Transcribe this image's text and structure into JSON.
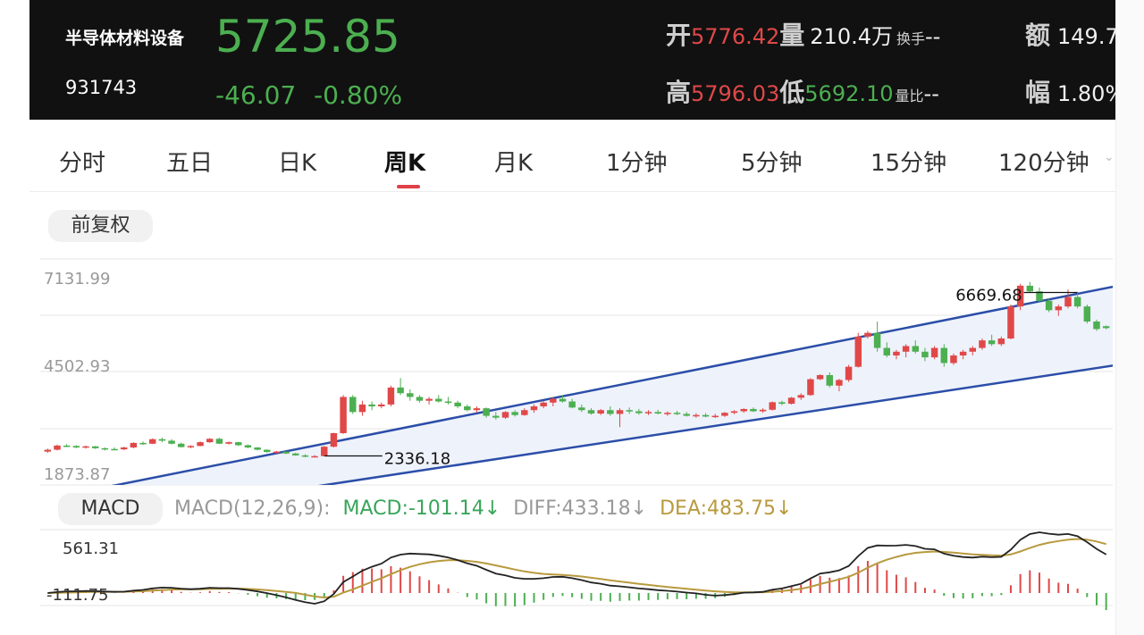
{
  "header": {
    "name": "半导体材料设备",
    "code": "931743",
    "price": "5725.85",
    "change": "-46.07",
    "change_pct": "-0.80%",
    "stats": {
      "open_label": "开",
      "open_value": "5776.42",
      "volume_label": "量",
      "volume_value": "210.4万",
      "turnover_label": "换手",
      "turnover_value": "--",
      "amount_label": "额",
      "amount_value": "149.7",
      "high_label": "高",
      "high_value": "5796.03",
      "low_label": "低",
      "low_value": "5692.10",
      "vol_ratio_label": "量比",
      "vol_ratio_value": "--",
      "amplitude_label": "幅",
      "amplitude_value": "1.80%"
    }
  },
  "tabs": [
    {
      "label": "分时"
    },
    {
      "label": "五日"
    },
    {
      "label": "日K"
    },
    {
      "label": "周K"
    },
    {
      "label": "月K"
    },
    {
      "label": "1分钟"
    },
    {
      "label": "5分钟"
    },
    {
      "label": "15分钟"
    },
    {
      "label": "120分钟"
    }
  ],
  "active_tab": "周K",
  "adjust_label": "前复权",
  "macd_panel": {
    "button_label": "MACD",
    "params_label": "MACD(12,26,9):",
    "macd_label": "MACD:-101.14↓",
    "diff_label": "DIFF:433.18↓",
    "dea_label": "DEA:483.75↓"
  },
  "colors": {
    "up": "#e04848",
    "down": "#4caf50",
    "channel": "#2b4ea8",
    "channel_fill": "#eef2fb",
    "dea": "#b89a3e",
    "diff": "#222222",
    "header_bg": "#111111"
  },
  "chart_data": [
    {
      "type": "candlestick",
      "y_tick_labels": [
        "7131.99",
        "4502.93",
        "1873.87"
      ],
      "ylim": [
        1873.87,
        7131.99
      ],
      "annotations": [
        {
          "label": "6669.68",
          "value": 6669.68,
          "kind": "high"
        },
        {
          "label": "2336.18",
          "value": 2336.18,
          "kind": "low"
        }
      ],
      "channel": {
        "upper": [
          [
            0,
            1200
          ],
          [
            119,
            7190
          ]
        ],
        "lower": [
          [
            0,
            450
          ],
          [
            119,
            5010
          ]
        ]
      },
      "ohlc": [
        [
          2450,
          2530,
          2420,
          2500
        ],
        [
          2500,
          2640,
          2480,
          2610
        ],
        [
          2610,
          2650,
          2570,
          2600
        ],
        [
          2600,
          2620,
          2540,
          2560
        ],
        [
          2560,
          2610,
          2530,
          2590
        ],
        [
          2590,
          2600,
          2520,
          2540
        ],
        [
          2540,
          2560,
          2480,
          2520
        ],
        [
          2520,
          2560,
          2490,
          2510
        ],
        [
          2510,
          2580,
          2490,
          2560
        ],
        [
          2560,
          2700,
          2540,
          2680
        ],
        [
          2680,
          2720,
          2630,
          2660
        ],
        [
          2660,
          2800,
          2650,
          2780
        ],
        [
          2780,
          2820,
          2700,
          2740
        ],
        [
          2740,
          2780,
          2640,
          2660
        ],
        [
          2660,
          2690,
          2560,
          2570
        ],
        [
          2570,
          2620,
          2540,
          2600
        ],
        [
          2600,
          2720,
          2590,
          2700
        ],
        [
          2700,
          2810,
          2680,
          2790
        ],
        [
          2790,
          2820,
          2650,
          2660
        ],
        [
          2660,
          2720,
          2640,
          2700
        ],
        [
          2700,
          2710,
          2600,
          2620
        ],
        [
          2620,
          2640,
          2540,
          2560
        ],
        [
          2560,
          2570,
          2480,
          2500
        ],
        [
          2500,
          2510,
          2420,
          2440
        ],
        [
          2440,
          2470,
          2400,
          2450
        ],
        [
          2450,
          2460,
          2380,
          2400
        ],
        [
          2400,
          2420,
          2340,
          2350
        ],
        [
          2350,
          2380,
          2300,
          2320
        ],
        [
          2320,
          2360,
          2310,
          2330
        ],
        [
          2330,
          2600,
          2336,
          2580
        ],
        [
          2580,
          2950,
          2560,
          2940
        ],
        [
          2940,
          3950,
          2920,
          3900
        ],
        [
          3900,
          3950,
          3450,
          3500
        ],
        [
          3500,
          3800,
          3400,
          3700
        ],
        [
          3700,
          3780,
          3550,
          3650
        ],
        [
          3650,
          3750,
          3600,
          3700
        ],
        [
          3700,
          4200,
          3650,
          4150
        ],
        [
          4150,
          4400,
          3950,
          4000
        ],
        [
          4000,
          4100,
          3800,
          3900
        ],
        [
          3900,
          3950,
          3750,
          3800
        ],
        [
          3800,
          3900,
          3700,
          3850
        ],
        [
          3850,
          3950,
          3750,
          3780
        ],
        [
          3780,
          3900,
          3700,
          3750
        ],
        [
          3750,
          3800,
          3600,
          3650
        ],
        [
          3650,
          3700,
          3520,
          3550
        ],
        [
          3550,
          3650,
          3480,
          3600
        ],
        [
          3600,
          3620,
          3350,
          3400
        ],
        [
          3400,
          3500,
          3300,
          3350
        ],
        [
          3350,
          3520,
          3320,
          3500
        ],
        [
          3500,
          3550,
          3380,
          3420
        ],
        [
          3420,
          3600,
          3400,
          3550
        ],
        [
          3550,
          3700,
          3480,
          3650
        ],
        [
          3650,
          3800,
          3600,
          3750
        ],
        [
          3750,
          3900,
          3650,
          3850
        ],
        [
          3850,
          3950,
          3750,
          3780
        ],
        [
          3780,
          3850,
          3600,
          3620
        ],
        [
          3620,
          3700,
          3500,
          3550
        ],
        [
          3550,
          3600,
          3430,
          3460
        ],
        [
          3460,
          3580,
          3420,
          3550
        ],
        [
          3550,
          3650,
          3400,
          3450
        ],
        [
          3450,
          3600,
          3100,
          3550
        ],
        [
          3550,
          3620,
          3450,
          3520
        ],
        [
          3520,
          3580,
          3430,
          3470
        ],
        [
          3470,
          3550,
          3420,
          3500
        ],
        [
          3500,
          3560,
          3440,
          3460
        ],
        [
          3460,
          3520,
          3400,
          3480
        ],
        [
          3480,
          3530,
          3420,
          3450
        ],
        [
          3450,
          3500,
          3380,
          3400
        ],
        [
          3400,
          3470,
          3350,
          3420
        ],
        [
          3420,
          3470,
          3360,
          3380
        ],
        [
          3380,
          3450,
          3340,
          3400
        ],
        [
          3400,
          3500,
          3370,
          3480
        ],
        [
          3480,
          3550,
          3440,
          3520
        ],
        [
          3520,
          3600,
          3480,
          3580
        ],
        [
          3580,
          3620,
          3500,
          3520
        ],
        [
          3520,
          3600,
          3480,
          3560
        ],
        [
          3560,
          3780,
          3540,
          3760
        ],
        [
          3760,
          3800,
          3680,
          3720
        ],
        [
          3720,
          3900,
          3700,
          3880
        ],
        [
          3880,
          4000,
          3820,
          3950
        ],
        [
          3950,
          4400,
          3930,
          4370
        ],
        [
          4370,
          4500,
          4350,
          4480
        ],
        [
          4480,
          4550,
          4150,
          4200
        ],
        [
          4200,
          4380,
          4050,
          4350
        ],
        [
          4350,
          4750,
          4300,
          4700
        ],
        [
          4700,
          5600,
          4680,
          5500
        ],
        [
          5500,
          5650,
          5450,
          5600
        ],
        [
          5600,
          5900,
          5100,
          5200
        ],
        [
          5200,
          5350,
          4950,
          5000
        ],
        [
          5000,
          5150,
          4900,
          5100
        ],
        [
          5100,
          5300,
          4950,
          5250
        ],
        [
          5250,
          5400,
          5050,
          5100
        ],
        [
          5100,
          5200,
          4850,
          4950
        ],
        [
          4950,
          5250,
          4900,
          5200
        ],
        [
          5200,
          5300,
          4700,
          4800
        ],
        [
          4800,
          5050,
          4750,
          5000
        ],
        [
          5000,
          5150,
          4900,
          5100
        ],
        [
          5100,
          5250,
          5000,
          5200
        ],
        [
          5200,
          5450,
          5150,
          5400
        ],
        [
          5400,
          5550,
          5250,
          5300
        ],
        [
          5300,
          5500,
          5250,
          5450
        ],
        [
          5450,
          6350,
          5430,
          6300
        ],
        [
          6300,
          6900,
          6200,
          6850
        ],
        [
          6850,
          6950,
          6669.68,
          6700
        ],
        [
          6700,
          6800,
          6400,
          6450
        ],
        [
          6450,
          6500,
          6150,
          6200
        ],
        [
          6200,
          6350,
          6050,
          6300
        ],
        [
          6300,
          6750,
          6250,
          6550
        ],
        [
          6550,
          6650,
          6250,
          6300
        ],
        [
          6300,
          6350,
          5850,
          5900
        ],
        [
          5900,
          5950,
          5650,
          5700
        ],
        [
          5776.42,
          5796.03,
          5692.1,
          5725.85
        ]
      ]
    },
    {
      "type": "macd",
      "params": "12,26,9",
      "y_tick_labels": [
        "561.31",
        "-111.75"
      ],
      "ylim": [
        -111.75,
        561.31
      ],
      "latest": {
        "macd": -101.14,
        "diff": 433.18,
        "dea": 483.75
      }
    }
  ]
}
